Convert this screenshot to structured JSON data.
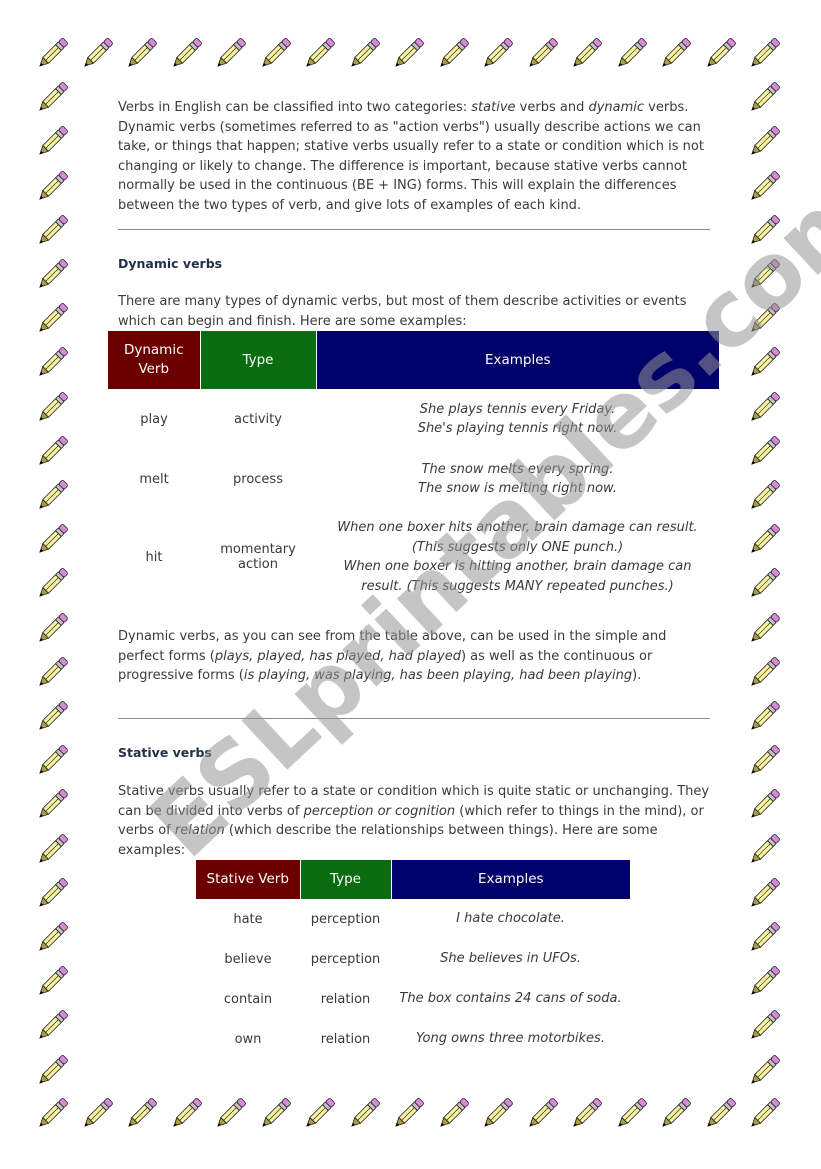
{
  "document": {
    "intro": {
      "segments": [
        {
          "t": "Verbs in English can be classified into two categories: "
        },
        {
          "t": "stative",
          "i": true
        },
        {
          "t": " verbs and "
        },
        {
          "t": "dynamic",
          "i": true
        },
        {
          "t": " verbs. Dynamic verbs (sometimes referred to as \"action verbs\") usually describe actions we can take, or things that happen; stative verbs usually refer to a state or condition which is not changing or likely to change. The difference is important, because stative verbs cannot normally be used in the continuous (BE + ING) forms. This will explain the differences between the two types of verb, and give lots of examples of each kind."
        }
      ]
    },
    "dynamic_section": {
      "heading": "Dynamic verbs",
      "intro": "There are many types of dynamic verbs, but most of them describe activities or events which can begin and finish. Here are some examples:",
      "table": {
        "headers": [
          "Dynamic Verb",
          "Type",
          "Examples"
        ],
        "rows": [
          {
            "verb": "play",
            "type": "activity",
            "examples": [
              "She plays tennis every Friday.",
              "She's playing tennis right now."
            ]
          },
          {
            "verb": "melt",
            "type": "process",
            "examples": [
              "The snow melts every spring.",
              "The snow is melting right now."
            ]
          },
          {
            "verb": "hit",
            "type": "momentary action",
            "examples": [
              "When one boxer hits another, brain damage can result. (This suggests only ONE punch.)",
              "When one boxer is hitting another, brain damage can result. (This suggests MANY repeated punches.)"
            ]
          }
        ]
      },
      "outro": {
        "segments": [
          {
            "t": "Dynamic verbs, as you can see from the table above, can be used in the simple and perfect forms ("
          },
          {
            "t": "plays, played, has played, had played",
            "i": true
          },
          {
            "t": ") as well as the continuous or progressive forms ("
          },
          {
            "t": "is playing, was playing, has been playing, had been playing",
            "i": true
          },
          {
            "t": ")."
          }
        ]
      }
    },
    "stative_section": {
      "heading": "Stative verbs",
      "intro": {
        "segments": [
          {
            "t": "Stative verbs usually refer to a state or condition which is quite static or unchanging. They can be divided into verbs of "
          },
          {
            "t": "perception or cognition",
            "i": true
          },
          {
            "t": " (which refer to things in the mind), or verbs of "
          },
          {
            "t": "relation",
            "i": true
          },
          {
            "t": " (which describe the relationships between things). Here are some examples:"
          }
        ]
      },
      "table": {
        "headers": [
          "Stative Verb",
          "Type",
          "Examples"
        ],
        "rows": [
          {
            "verb": "hate",
            "type": "perception",
            "example": "I hate chocolate."
          },
          {
            "verb": "believe",
            "type": "perception",
            "example": "She believes in UFOs."
          },
          {
            "verb": "contain",
            "type": "relation",
            "example": "The box contains 24 cans of soda."
          },
          {
            "verb": "own",
            "type": "relation",
            "example": "Yong owns three motorbikes."
          }
        ]
      }
    },
    "watermark": "ESLprintables.com",
    "border": {
      "icon": "pencil-icon",
      "colors": {
        "eraser": "#d98ad9",
        "ferrule": "#c8c0c8",
        "body": "#f6f2a0",
        "tip": "#a8a040",
        "lead": "#000000"
      }
    },
    "colors": {
      "verb_header": "#6b0000",
      "type_header": "#0b6b10",
      "examples_header": "#00006b",
      "heading": "#1f3048"
    }
  }
}
